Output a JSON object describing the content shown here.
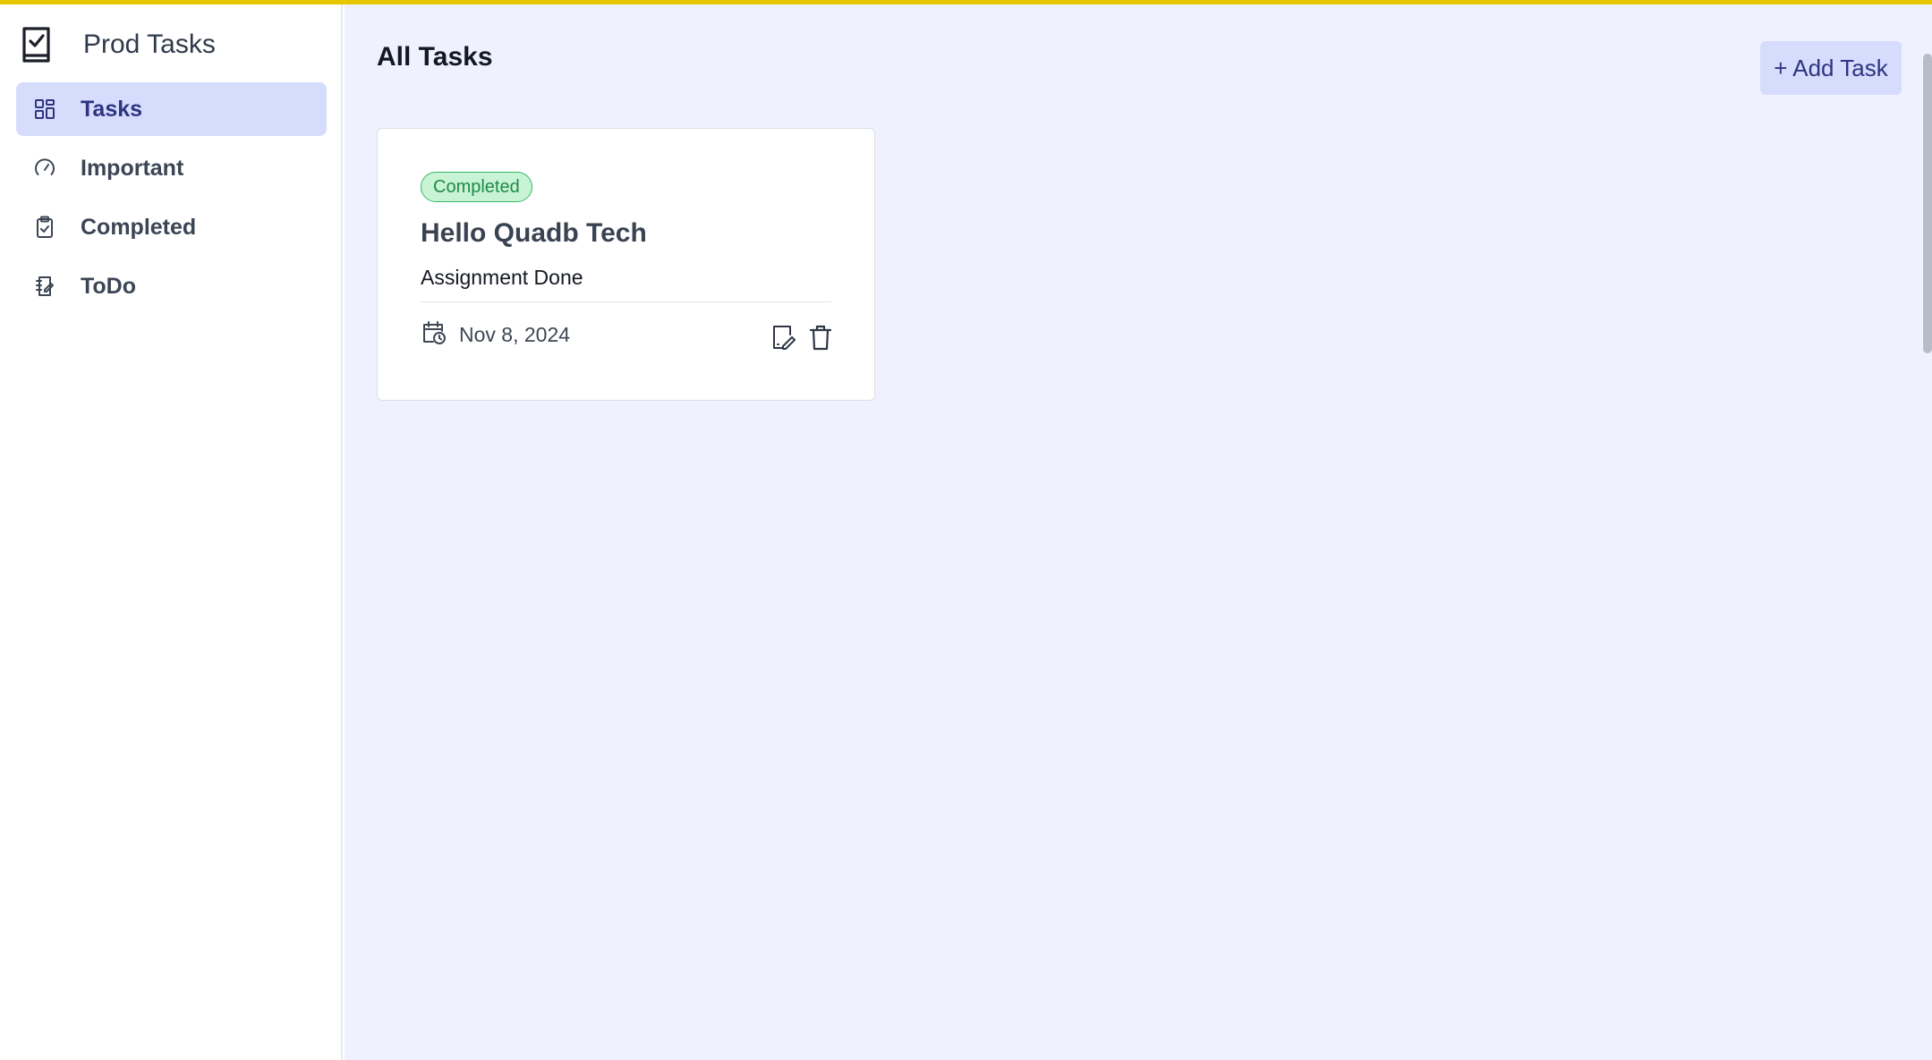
{
  "brand": {
    "title": "Prod Tasks",
    "icon": "task-list-icon"
  },
  "sidebar": {
    "items": [
      {
        "label": "Tasks",
        "icon": "grid-icon",
        "active": true
      },
      {
        "label": "Important",
        "icon": "gauge-icon",
        "active": false
      },
      {
        "label": "Completed",
        "icon": "clipboard-check-icon",
        "active": false
      },
      {
        "label": "ToDo",
        "icon": "notebook-edit-icon",
        "active": false
      }
    ]
  },
  "main": {
    "title": "All Tasks",
    "add_button_label": "+ Add Task"
  },
  "tasks": [
    {
      "status": "Completed",
      "title": "Hello Quadb Tech",
      "description": "Assignment Done",
      "date": "Nov 8, 2024"
    }
  ],
  "colors": {
    "accent": "#d6dcfc",
    "accent_text": "#2d3580",
    "main_background": "#eff2fe",
    "status_completed_bg": "#c8f4d5",
    "status_completed_text": "#1f8a48",
    "top_bar": "#e6c600"
  }
}
